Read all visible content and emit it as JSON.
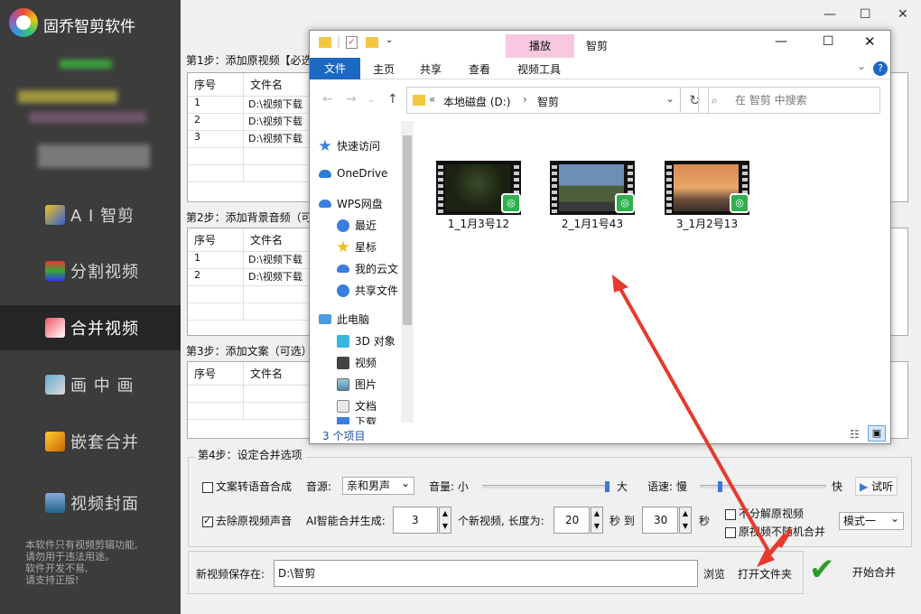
{
  "app": {
    "name": "固乔智剪软件"
  },
  "sidebar": {
    "items": [
      {
        "label": "A I 智剪",
        "icon": "ai-wand-icon"
      },
      {
        "label": "分割视频",
        "icon": "split-icon"
      },
      {
        "label": "合并视频",
        "icon": "merge-icon"
      },
      {
        "label": "画 中 画",
        "icon": "pip-icon"
      },
      {
        "label": "嵌套合并",
        "icon": "nest-icon"
      },
      {
        "label": "视频封面",
        "icon": "cover-icon"
      }
    ],
    "notice": [
      "本软件只有视频剪辑功能,",
      "请勿用于违法用途。",
      "软件开发不易,",
      "请支持正版!"
    ]
  },
  "step1": {
    "label": "第1步：添加原视频【必选",
    "headers": [
      "序号",
      "文件名"
    ],
    "rows": [
      [
        "1",
        "D:\\视频下载"
      ],
      [
        "2",
        "D:\\视频下载"
      ],
      [
        "3",
        "D:\\视频下载"
      ]
    ]
  },
  "step2": {
    "label": "第2步：添加背景音频（可",
    "headers": [
      "序号",
      "文件名"
    ],
    "rows": [
      [
        "1",
        "D:\\视频下载"
      ],
      [
        "2",
        "D:\\视频下载"
      ]
    ]
  },
  "step3": {
    "label": "第3步：添加文案（可选）",
    "headers": [
      "序号",
      "文件名"
    ]
  },
  "step4": {
    "label": "第4步：设定合并选项",
    "tts_label": "文案转语音合成",
    "voice_label": "音源:",
    "voice_value": "亲和男声",
    "volume_label": "音量: 小",
    "volume_max": "大",
    "speed_label": "语速: 慢",
    "speed_max": "快",
    "preview": "试听",
    "remove_audio_label": "去除原视频声音",
    "ai_label": "AI智能合并生成:",
    "count": "3",
    "count_suffix": "个新视频, 长度为:",
    "len_from": "20",
    "to_label": "秒 到",
    "len_to": "30",
    "sec_label": "秒",
    "no_split": "不分解原视频",
    "no_random": "原视频不随机合并",
    "mode": "模式一"
  },
  "save": {
    "label": "新视频保存在:",
    "path": "D:\\智剪",
    "browse": "浏览",
    "open_folder": "打开文件夹",
    "start": "开始合并"
  },
  "explorer": {
    "title": "智剪",
    "play_tab": "播放",
    "tabs": [
      "文件",
      "主页",
      "共享",
      "查看",
      "视频工具"
    ],
    "address": [
      "本地磁盘 (D:)",
      "智剪"
    ],
    "search_placeholder": "在 智剪 中搜索",
    "tree": [
      "快速访问",
      "OneDrive",
      "WPS网盘",
      "最近",
      "星标",
      "我的云文",
      "共享文件",
      "此电脑",
      "3D 对象",
      "视频",
      "图片",
      "文档",
      "下载"
    ],
    "files": [
      "1_1月3号12",
      "2_1月1号43",
      "3_1月2号13"
    ],
    "status": "3 个项目"
  },
  "colors": {
    "sidebar": "#3c3c3c",
    "accent": "#1b69c2",
    "arrow": "#e8392f",
    "play_tab": "#f7c8df"
  }
}
